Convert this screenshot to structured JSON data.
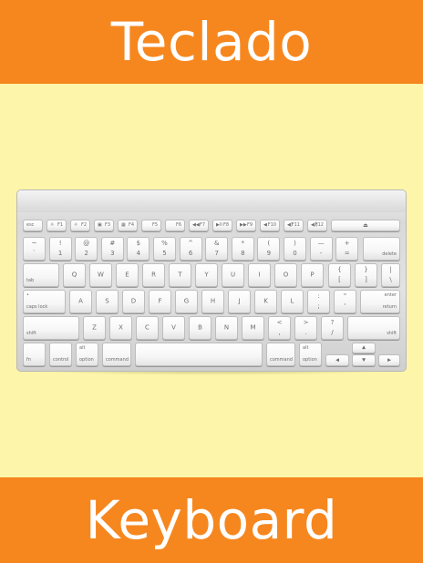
{
  "banner_top": {
    "title": "Teclado"
  },
  "banner_bottom": {
    "title": "Keyboard"
  },
  "keys": {
    "esc": "esc",
    "f1": "F1",
    "f2": "F2",
    "f3": "F3",
    "f4": "F4",
    "f5": "F5",
    "f6": "F6",
    "f7": "F7",
    "f8": "F8",
    "f9": "F9",
    "f10": "F10",
    "f11": "F11",
    "f12": "F12",
    "eject": "⏏",
    "f1_icon": "☼",
    "f2_icon": "☼",
    "f3_icon": "▣",
    "f4_icon": "▦",
    "f7_icon": "◀◀",
    "f8_icon": "▶II",
    "f9_icon": "▶▶",
    "f10_icon": "◀",
    "f11_icon": "◀)",
    "f12_icon": "◀))",
    "num_row": [
      {
        "top": "~",
        "bottom": "`"
      },
      {
        "top": "!",
        "bottom": "1"
      },
      {
        "top": "@",
        "bottom": "2"
      },
      {
        "top": "#",
        "bottom": "3"
      },
      {
        "top": "$",
        "bottom": "4"
      },
      {
        "top": "%",
        "bottom": "5"
      },
      {
        "top": "^",
        "bottom": "6"
      },
      {
        "top": "&",
        "bottom": "7"
      },
      {
        "top": "*",
        "bottom": "8"
      },
      {
        "top": "(",
        "bottom": "9"
      },
      {
        "top": ")",
        "bottom": "0"
      },
      {
        "top": "—",
        "bottom": "-"
      },
      {
        "top": "+",
        "bottom": "="
      }
    ],
    "delete": "delete",
    "tab": "tab",
    "q_row": [
      "Q",
      "W",
      "E",
      "R",
      "T",
      "Y",
      "U",
      "I",
      "O",
      "P"
    ],
    "brace_l": {
      "top": "{",
      "bottom": "["
    },
    "brace_r": {
      "top": "}",
      "bottom": "]"
    },
    "pipe": {
      "top": "|",
      "bottom": "\\"
    },
    "caps_lock": "caps lock",
    "caps_dot": "•",
    "a_row": [
      "A",
      "S",
      "D",
      "F",
      "G",
      "H",
      "J",
      "K",
      "L"
    ],
    "colon": {
      "top": ":",
      "bottom": ";"
    },
    "quote": {
      "top": "\"",
      "bottom": "'"
    },
    "enter": "enter",
    "return": "return",
    "shift_l": "shift",
    "z_row": [
      "Z",
      "X",
      "C",
      "V",
      "B",
      "N",
      "M"
    ],
    "lt": {
      "top": "<",
      "bottom": ","
    },
    "gt": {
      "top": ">",
      "bottom": "."
    },
    "question": {
      "top": "?",
      "bottom": "/"
    },
    "shift_r": "shift",
    "fn": "fn",
    "control": "control",
    "alt_l": "alt",
    "option_l": "option",
    "command_l": "command",
    "command_r": "command",
    "alt_r": "alt",
    "option_r": "option",
    "arrow_up": "▲",
    "arrow_left": "◀",
    "arrow_down": "▼",
    "arrow_right": "▶"
  }
}
